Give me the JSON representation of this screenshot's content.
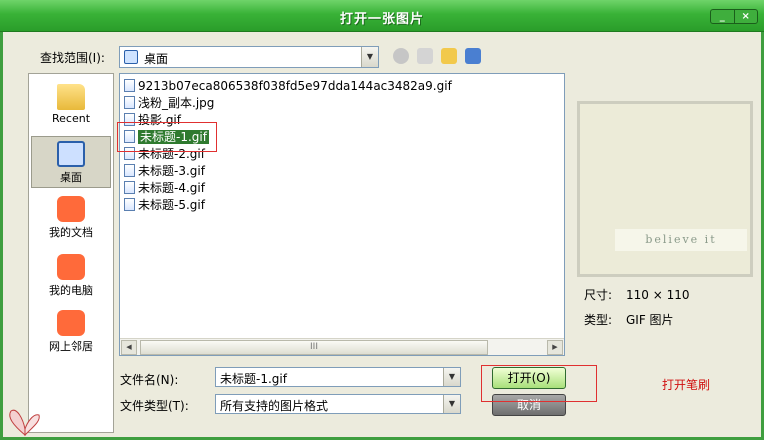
{
  "window": {
    "title": "打开一张图片",
    "controls": [
      "_",
      "×"
    ]
  },
  "lookin": {
    "label": "查找范围(I):",
    "value": "桌面"
  },
  "places": [
    {
      "label": "Recent",
      "icon": "folder-icon"
    },
    {
      "label": "桌面",
      "icon": "desktop-icon",
      "selected": true
    },
    {
      "label": "我的文档",
      "icon": "my-documents-icon"
    },
    {
      "label": "我的电脑",
      "icon": "my-computer-icon"
    },
    {
      "label": "网上邻居",
      "icon": "network-icon"
    }
  ],
  "files": [
    "9213b07eca806538f038fd5e97dda144ac3482a9.gif",
    "浅粉_副本.jpg",
    "投影.gif",
    "未标题-1.gif",
    "未标题-2.gif",
    "未标题-3.gif",
    "未标题-4.gif",
    "未标题-5.gif"
  ],
  "selected_file_index": 3,
  "scrollbar": {
    "thumb_label": "III"
  },
  "preview": {
    "text": "believe it"
  },
  "info": {
    "size_label": "尺寸:",
    "size_value": "110 × 110",
    "type_label": "类型:",
    "type_value": "GIF 图片"
  },
  "filename": {
    "label": "文件名(N):",
    "value": "未标题-1.gif"
  },
  "filetype": {
    "label": "文件类型(T):",
    "value": "所有支持的图片格式"
  },
  "buttons": {
    "open": "打开(O)",
    "cancel": "取消"
  },
  "annotation": "打开笔刷",
  "colors": {
    "title_green": "#39b237",
    "highlight_red": "#e03030",
    "selection_green": "#2f7a2f"
  }
}
